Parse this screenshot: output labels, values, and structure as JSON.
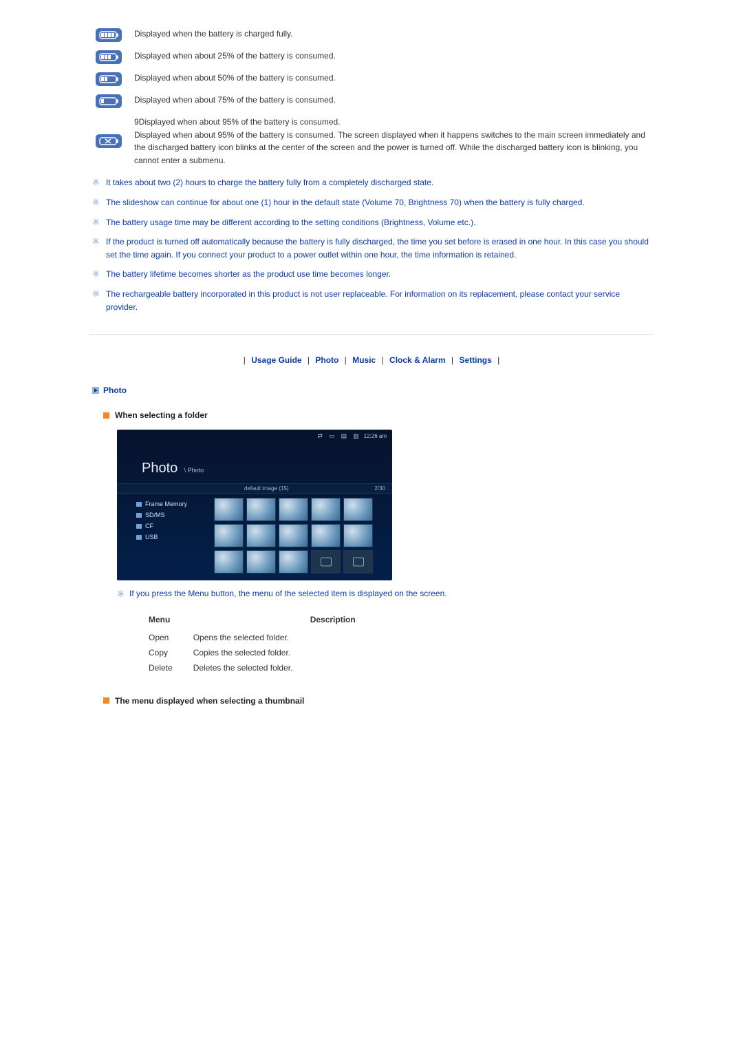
{
  "battery": [
    {
      "level": 4,
      "desc": "Displayed when the battery is charged fully."
    },
    {
      "level": 3,
      "desc": "Displayed when about 25% of the battery is consumed."
    },
    {
      "level": 2,
      "desc": "Displayed when about 50% of the battery is consumed."
    },
    {
      "level": 1,
      "desc": "Displayed when about 75% of the battery is consumed."
    },
    {
      "level": 0,
      "desc": "9Displayed when about 95% of the battery is consumed.\nDisplayed when about 95% of the battery is consumed. The screen displayed when it happens switches to the main screen immediately and the discharged battery icon blinks at the center of the screen and the power is turned off. While the discharged battery icon is blinking, you cannot enter a submenu."
    }
  ],
  "notes": [
    "It takes about two (2) hours to charge the battery fully from a completely discharged state.",
    "The slideshow can continue for about one (1) hour in the default state (Volume 70, Brightness 70) when the battery is fully charged.",
    "The battery usage time may be different according to the setting conditions (Brightness, Volume etc.).",
    "If the product is turned off automatically because the battery is fully discharged, the time you set before is erased in one hour. In this case you should set the time again. If you connect your product to a power outlet within one hour, the time information is retained.",
    "The battery lifetime becomes shorter as the product use time becomes longer.",
    "The rechargeable battery incorporated in this product is not user replaceable. For information on its replacement, please contact your service provider."
  ],
  "nav": [
    "Usage Guide",
    "Photo",
    "Music",
    "Clock & Alarm",
    "Settings"
  ],
  "heading_photo": "Photo",
  "heading_folder": "When selecting a folder",
  "folder_note": "If you press the Menu button, the menu of the selected item is displayed on the screen.",
  "device": {
    "time": "12:26 am",
    "title": "Photo",
    "breadcrumb": "\\ Photo",
    "info_label": "default image (15)",
    "info_count": "2/30",
    "side": [
      "Frame Memory",
      "SD/MS",
      "CF",
      "USB"
    ]
  },
  "menu_table": {
    "head_menu": "Menu",
    "head_desc": "Description",
    "rows": [
      {
        "menu": "Open",
        "desc": "Opens the selected folder."
      },
      {
        "menu": "Copy",
        "desc": "Copies the selected folder."
      },
      {
        "menu": "Delete",
        "desc": "Deletes the selected folder."
      }
    ]
  },
  "heading_thumb": "The menu displayed when selecting a thumbnail"
}
